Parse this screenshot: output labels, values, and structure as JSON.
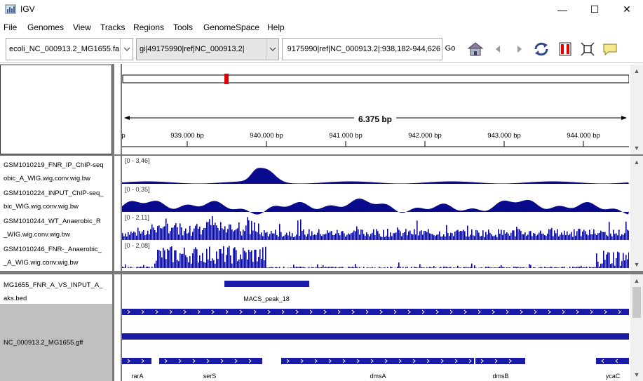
{
  "window": {
    "title": "IGV",
    "minimize": "—",
    "maximize": "☐",
    "close": "✕"
  },
  "menu": [
    "File",
    "Genomes",
    "View",
    "Tracks",
    "Regions",
    "Tools",
    "GenomeSpace",
    "Help"
  ],
  "toolbar": {
    "genome": "ecoli_NC_000913.2_MG1655.fa",
    "chromosome": "gi|49175990|ref|NC_000913.2|",
    "locus": "9175990|ref|NC_000913.2|:938,182-944,626",
    "go": "Go",
    "icons": [
      "home-icon",
      "back-icon",
      "forward-icon",
      "refresh-icon",
      "roi-icon",
      "fit-window-icon",
      "popup-info-icon"
    ]
  },
  "ruler": {
    "span": "6.375 bp",
    "ticks": [
      "939.000 bp",
      "940.000 bp",
      "941.000 bp",
      "942.000 bp",
      "943.000 bp",
      "944.000 bp"
    ],
    "partial_tick": "p"
  },
  "data_tracks": [
    {
      "name_lines": [
        "GSM1010219_FNR_IP_ChIP-seq",
        "obic_A_WIG.wig.conv.wig.bw"
      ],
      "range": "[0 - 3,46]"
    },
    {
      "name_lines": [
        "GSM1010224_INPUT_ChIP-seq_",
        "bic_WIG.wig.conv.wig.bw"
      ],
      "range": "[0 - 0,35]"
    },
    {
      "name_lines": [
        "GSM1010244_WT_Anaerobic_R",
        "_WIG.wig.conv.wig.bw"
      ],
      "range": "[0 - 2,11]"
    },
    {
      "name_lines": [
        "GSM1010246_FNR-_Anaerobic_",
        "_A_WIG.wig.conv.wig.bw"
      ],
      "range": "[0 - 2,08]"
    }
  ],
  "feature_tracks": {
    "bed_name_lines": [
      "MG1655_FNR_A_VS_INPUT_A_",
      "aks.bed"
    ],
    "bed_feature": "MACS_peak_18",
    "gff_name": "NC_000913.2_MG1655.gff",
    "genes": [
      "rarA",
      "serS",
      "dmsA",
      "dmsB",
      "ycaC"
    ]
  },
  "colors": {
    "track_fill": "#0a0a8c",
    "feature": "#1a1aa8",
    "roi_red": "#e00000",
    "selected_name_bg": "#c0c0c0"
  }
}
